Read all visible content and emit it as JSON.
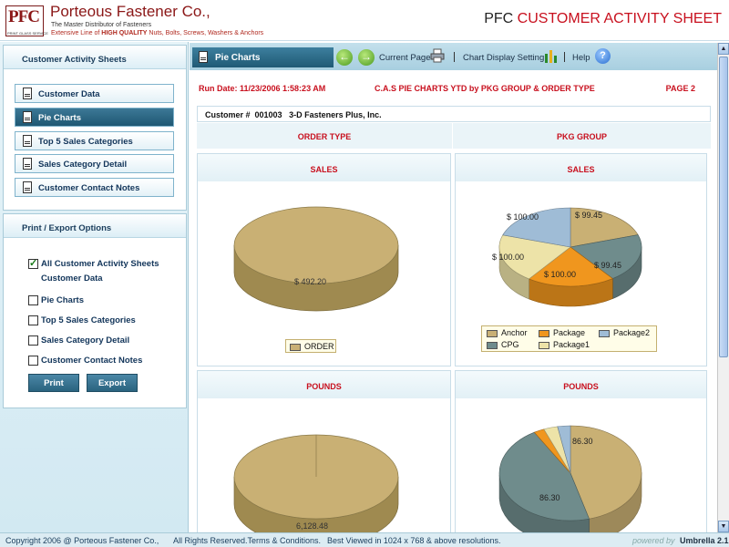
{
  "header": {
    "logo_text": "PFC",
    "logo_sub": "PRINT GLASS SERVICE",
    "company": "Porteous Fastener Co.,",
    "tagline1": "The Master Distributor of Fasteners",
    "tagline2_prefix": "Extensive Line of ",
    "tagline2_bold": "HIGH QUALITY",
    "tagline2_suffix": " Nuts, Bolts, Screws, Washers & Anchors",
    "page_title_prefix": "PFC ",
    "page_title_accent": "CUSTOMER ACTIVITY SHEET"
  },
  "sidebar": {
    "section1_title": "Customer Activity Sheets",
    "items": [
      {
        "label": "Customer Data",
        "active": false
      },
      {
        "label": "Pie Charts",
        "active": true
      },
      {
        "label": "Top 5 Sales Categories",
        "active": false
      },
      {
        "label": "Sales Category Detail",
        "active": false
      },
      {
        "label": "Customer Contact Notes",
        "active": false
      }
    ],
    "section2_title": "Print / Export Options",
    "options": [
      {
        "label": "All Customer Activity Sheets",
        "checked": true
      },
      {
        "label": "Pie Charts",
        "checked": false
      },
      {
        "label": "Top 5 Sales Categories",
        "checked": false
      },
      {
        "label": "Sales Category Detail",
        "checked": false
      },
      {
        "label": "Customer Contact Notes",
        "checked": false
      }
    ],
    "option_sub_label": "Customer Data",
    "print_label": "Print",
    "export_label": "Export"
  },
  "toolbar": {
    "tab_label": "Pie Charts",
    "back_glyph": "←",
    "forward_glyph": "→",
    "current_page_label": "Current Page",
    "chart_display_label": "Chart Display Setting",
    "help_label": "Help",
    "help_glyph": "?",
    "separator": "|"
  },
  "report": {
    "run_date": "Run Date: 11/23/2006 1:58:23 AM",
    "title": "C.A.S PIE CHARTS YTD by PKG GROUP & ORDER TYPE",
    "page": "PAGE 2",
    "customer_label": "Customer #",
    "customer_number": "001003",
    "customer_name": "3-D Fasteners Plus, Inc.",
    "col_order_type": "ORDER TYPE",
    "col_pkg_group": "PKG GROUP"
  },
  "panels": {
    "sales_title": "SALES",
    "pounds_title": "POUNDS"
  },
  "chart_data": [
    {
      "type": "pie",
      "title": "SALES",
      "group": "ORDER TYPE",
      "series": [
        {
          "name": "ORDER",
          "values": [
            492.2
          ]
        }
      ],
      "categories": [
        "ORDER"
      ],
      "data_labels": [
        "$ 492.20"
      ],
      "legend": "bottom"
    },
    {
      "type": "pie",
      "title": "SALES",
      "group": "PKG GROUP",
      "categories": [
        "Anchor",
        "CPG",
        "Package",
        "Package1",
        "Package2"
      ],
      "values": [
        99.45,
        99.45,
        100.0,
        100.0,
        100.0
      ],
      "data_labels": [
        "$ 99.45",
        "$ 99.45",
        "$ 100.00",
        "$ 100.00",
        "$ 100.00"
      ],
      "colors": [
        "#c9b074",
        "#6f8c8c",
        "#f0961e",
        "#ede3a8",
        "#9fbcd6"
      ],
      "legend": "bottom"
    },
    {
      "type": "pie",
      "title": "POUNDS",
      "group": "ORDER TYPE",
      "categories": [
        "ORDER"
      ],
      "values": [
        6128.48
      ],
      "data_labels": [
        "6,128.48"
      ]
    },
    {
      "type": "pie",
      "title": "POUNDS",
      "group": "PKG GROUP",
      "categories": [
        "Anchor",
        "CPG",
        "Package",
        "Package1",
        "Package2"
      ],
      "values": [
        86.3,
        86.3,
        4.5,
        6.0,
        5.5
      ],
      "data_labels": [
        "86.30",
        "86.30"
      ],
      "colors": [
        "#c9b074",
        "#6f8c8c",
        "#f0961e",
        "#ede3a8",
        "#9fbcd6"
      ]
    }
  ],
  "footer": {
    "copyright": "Copyright 2006 @ Porteous Fastener Co.,",
    "rights": "All Rights Reserved.Terms & Conditions.",
    "resolution": "Best Viewed in 1024 x 768 & above resolutions.",
    "powered_by": "powered by",
    "brand": "Umbrella 2.1"
  },
  "colors": {
    "accent_red": "#c8101e",
    "nav_blue": "#1f5873",
    "order_gold": "#c9b074"
  }
}
